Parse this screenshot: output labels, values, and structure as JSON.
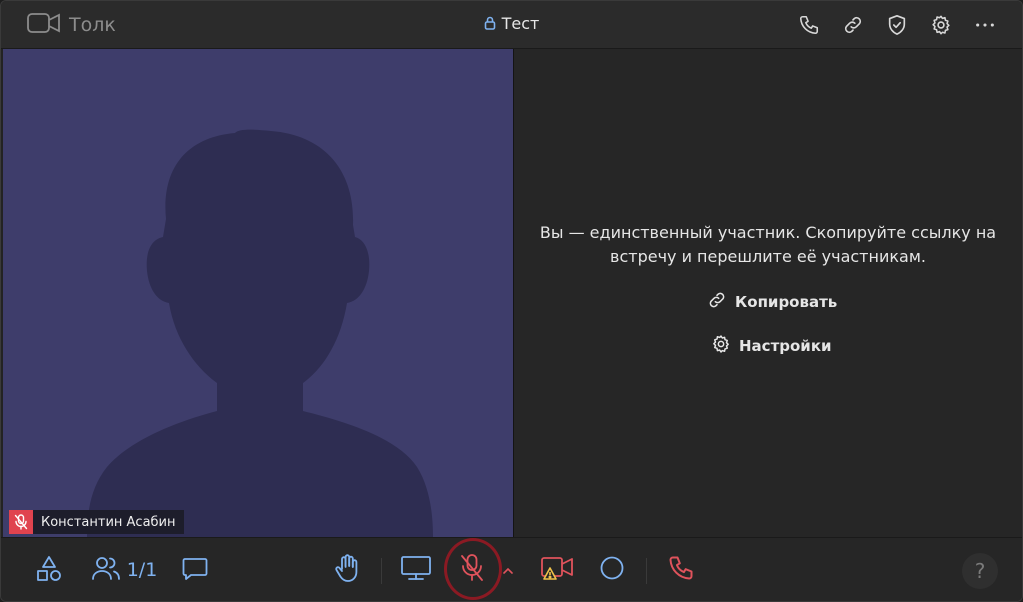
{
  "header": {
    "app_name": "Толк",
    "meeting_title": "Тест",
    "icons": [
      "camera-icon",
      "lock-icon",
      "phone-icon",
      "link-icon",
      "shield-check-icon",
      "gear-icon",
      "more-icon"
    ]
  },
  "participant": {
    "name": "Константин Асабин",
    "mic_state_icon": "mic-off-icon",
    "tile_color": "#3e3d6b"
  },
  "panel": {
    "message": "Вы — единственный участник. Скопируйте ссылку на встречу и перешлите её участникам.",
    "copy_label": "Копировать",
    "settings_label": "Настройки"
  },
  "toolbar": {
    "participants_count": "1/1",
    "help_label": "?",
    "accent_color": "#7fb2f0",
    "danger_color": "#e0535c"
  }
}
